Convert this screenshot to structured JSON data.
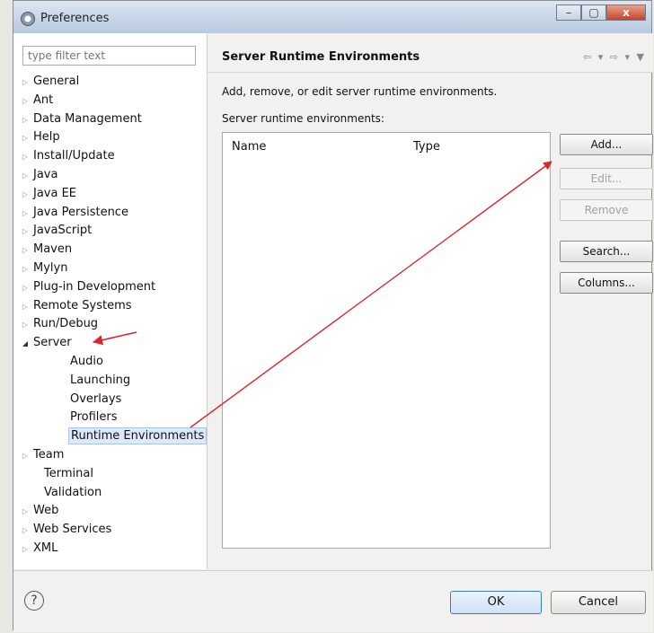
{
  "window": {
    "title": "Preferences",
    "minimize": "–",
    "maximize": "▢",
    "close": "x"
  },
  "filter": {
    "placeholder": "type filter text"
  },
  "tree": [
    {
      "label": "General",
      "arrow": "closed"
    },
    {
      "label": "Ant",
      "arrow": "closed"
    },
    {
      "label": "Data Management",
      "arrow": "closed"
    },
    {
      "label": "Help",
      "arrow": "closed"
    },
    {
      "label": "Install/Update",
      "arrow": "closed"
    },
    {
      "label": "Java",
      "arrow": "closed"
    },
    {
      "label": "Java EE",
      "arrow": "closed"
    },
    {
      "label": "Java Persistence",
      "arrow": "closed"
    },
    {
      "label": "JavaScript",
      "arrow": "closed"
    },
    {
      "label": "Maven",
      "arrow": "closed"
    },
    {
      "label": "Mylyn",
      "arrow": "closed"
    },
    {
      "label": "Plug-in Development",
      "arrow": "closed"
    },
    {
      "label": "Remote Systems",
      "arrow": "closed"
    },
    {
      "label": "Run/Debug",
      "arrow": "closed"
    },
    {
      "label": "Server",
      "arrow": "open"
    },
    {
      "label": "Audio",
      "arrow": "child"
    },
    {
      "label": "Launching",
      "arrow": "child"
    },
    {
      "label": "Overlays",
      "arrow": "child"
    },
    {
      "label": "Profilers",
      "arrow": "child"
    },
    {
      "label": "Runtime Environments",
      "arrow": "child",
      "selected": true
    },
    {
      "label": "Team",
      "arrow": "closed"
    },
    {
      "label": "Terminal",
      "arrow": "none"
    },
    {
      "label": "Validation",
      "arrow": "none"
    },
    {
      "label": "Web",
      "arrow": "closed"
    },
    {
      "label": "Web Services",
      "arrow": "closed"
    },
    {
      "label": "XML",
      "arrow": "closed"
    }
  ],
  "page": {
    "title": "Server Runtime Environments",
    "nav_arrows": "⇦ ▾ ⇨ ▾ ▼",
    "description": "Add, remove, or edit server runtime environments.",
    "list_label": "Server runtime environments:",
    "columns": [
      "Name",
      "Type"
    ]
  },
  "buttons": {
    "add": "Add...",
    "edit": "Edit...",
    "remove": "Remove",
    "search": "Search...",
    "columns": "Columns..."
  },
  "footer": {
    "help": "?",
    "ok": "OK",
    "cancel": "Cancel"
  },
  "annotation_color": "#d8262e"
}
